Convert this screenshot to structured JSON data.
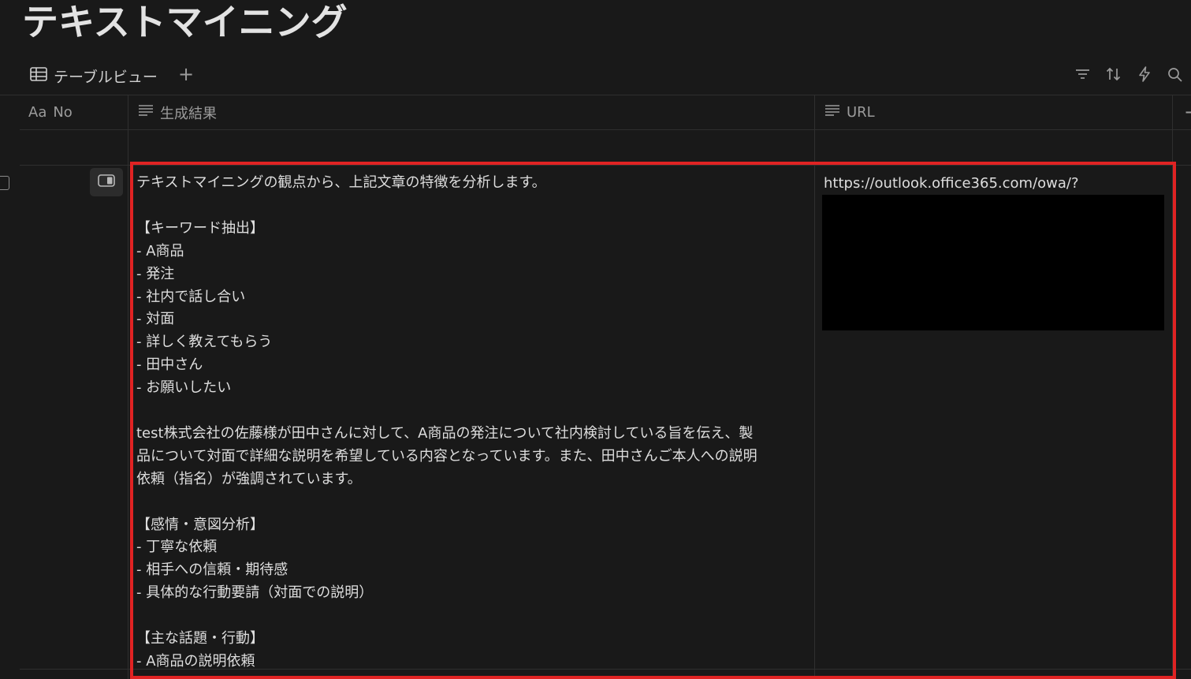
{
  "page": {
    "title": "テキストマイニング"
  },
  "view": {
    "tab_label": "テーブルビュー",
    "add_label": "+"
  },
  "columns": [
    {
      "prefix": "Aa",
      "label": "No"
    },
    {
      "label": "生成結果"
    },
    {
      "label": "URL"
    }
  ],
  "add_column_label": "+",
  "row": {
    "no": "",
    "result_lines": [
      "テキストマイニングの観点から、上記文章の特徴を分析します。",
      "",
      "【キーワード抽出】",
      "- A商品",
      "- 発注",
      "- 社内で話し合い",
      "- 対面",
      "- 詳しく教えてもらう",
      "- 田中さん",
      "- お願いしたい",
      "",
      "test株式会社の佐藤様が田中さんに対して、A商品の発注について社内検討している旨を伝え、製",
      "品について対面で詳細な説明を希望している内容となっています。また、田中さんご本人への説明",
      "依頼（指名）が強調されています。",
      "",
      "【感情・意図分析】",
      "- 丁寧な依頼",
      "- 相手への信頼・期待感",
      "- 具体的な行動要請（対面での説明）",
      "",
      "【主な話題・行動】",
      "- A商品の説明依頼"
    ],
    "url": "https://outlook.office365.com/owa/?"
  },
  "colors": {
    "background": "#191919",
    "highlight": "#e02323",
    "text": "#dedede",
    "muted": "#9b9b9b"
  }
}
